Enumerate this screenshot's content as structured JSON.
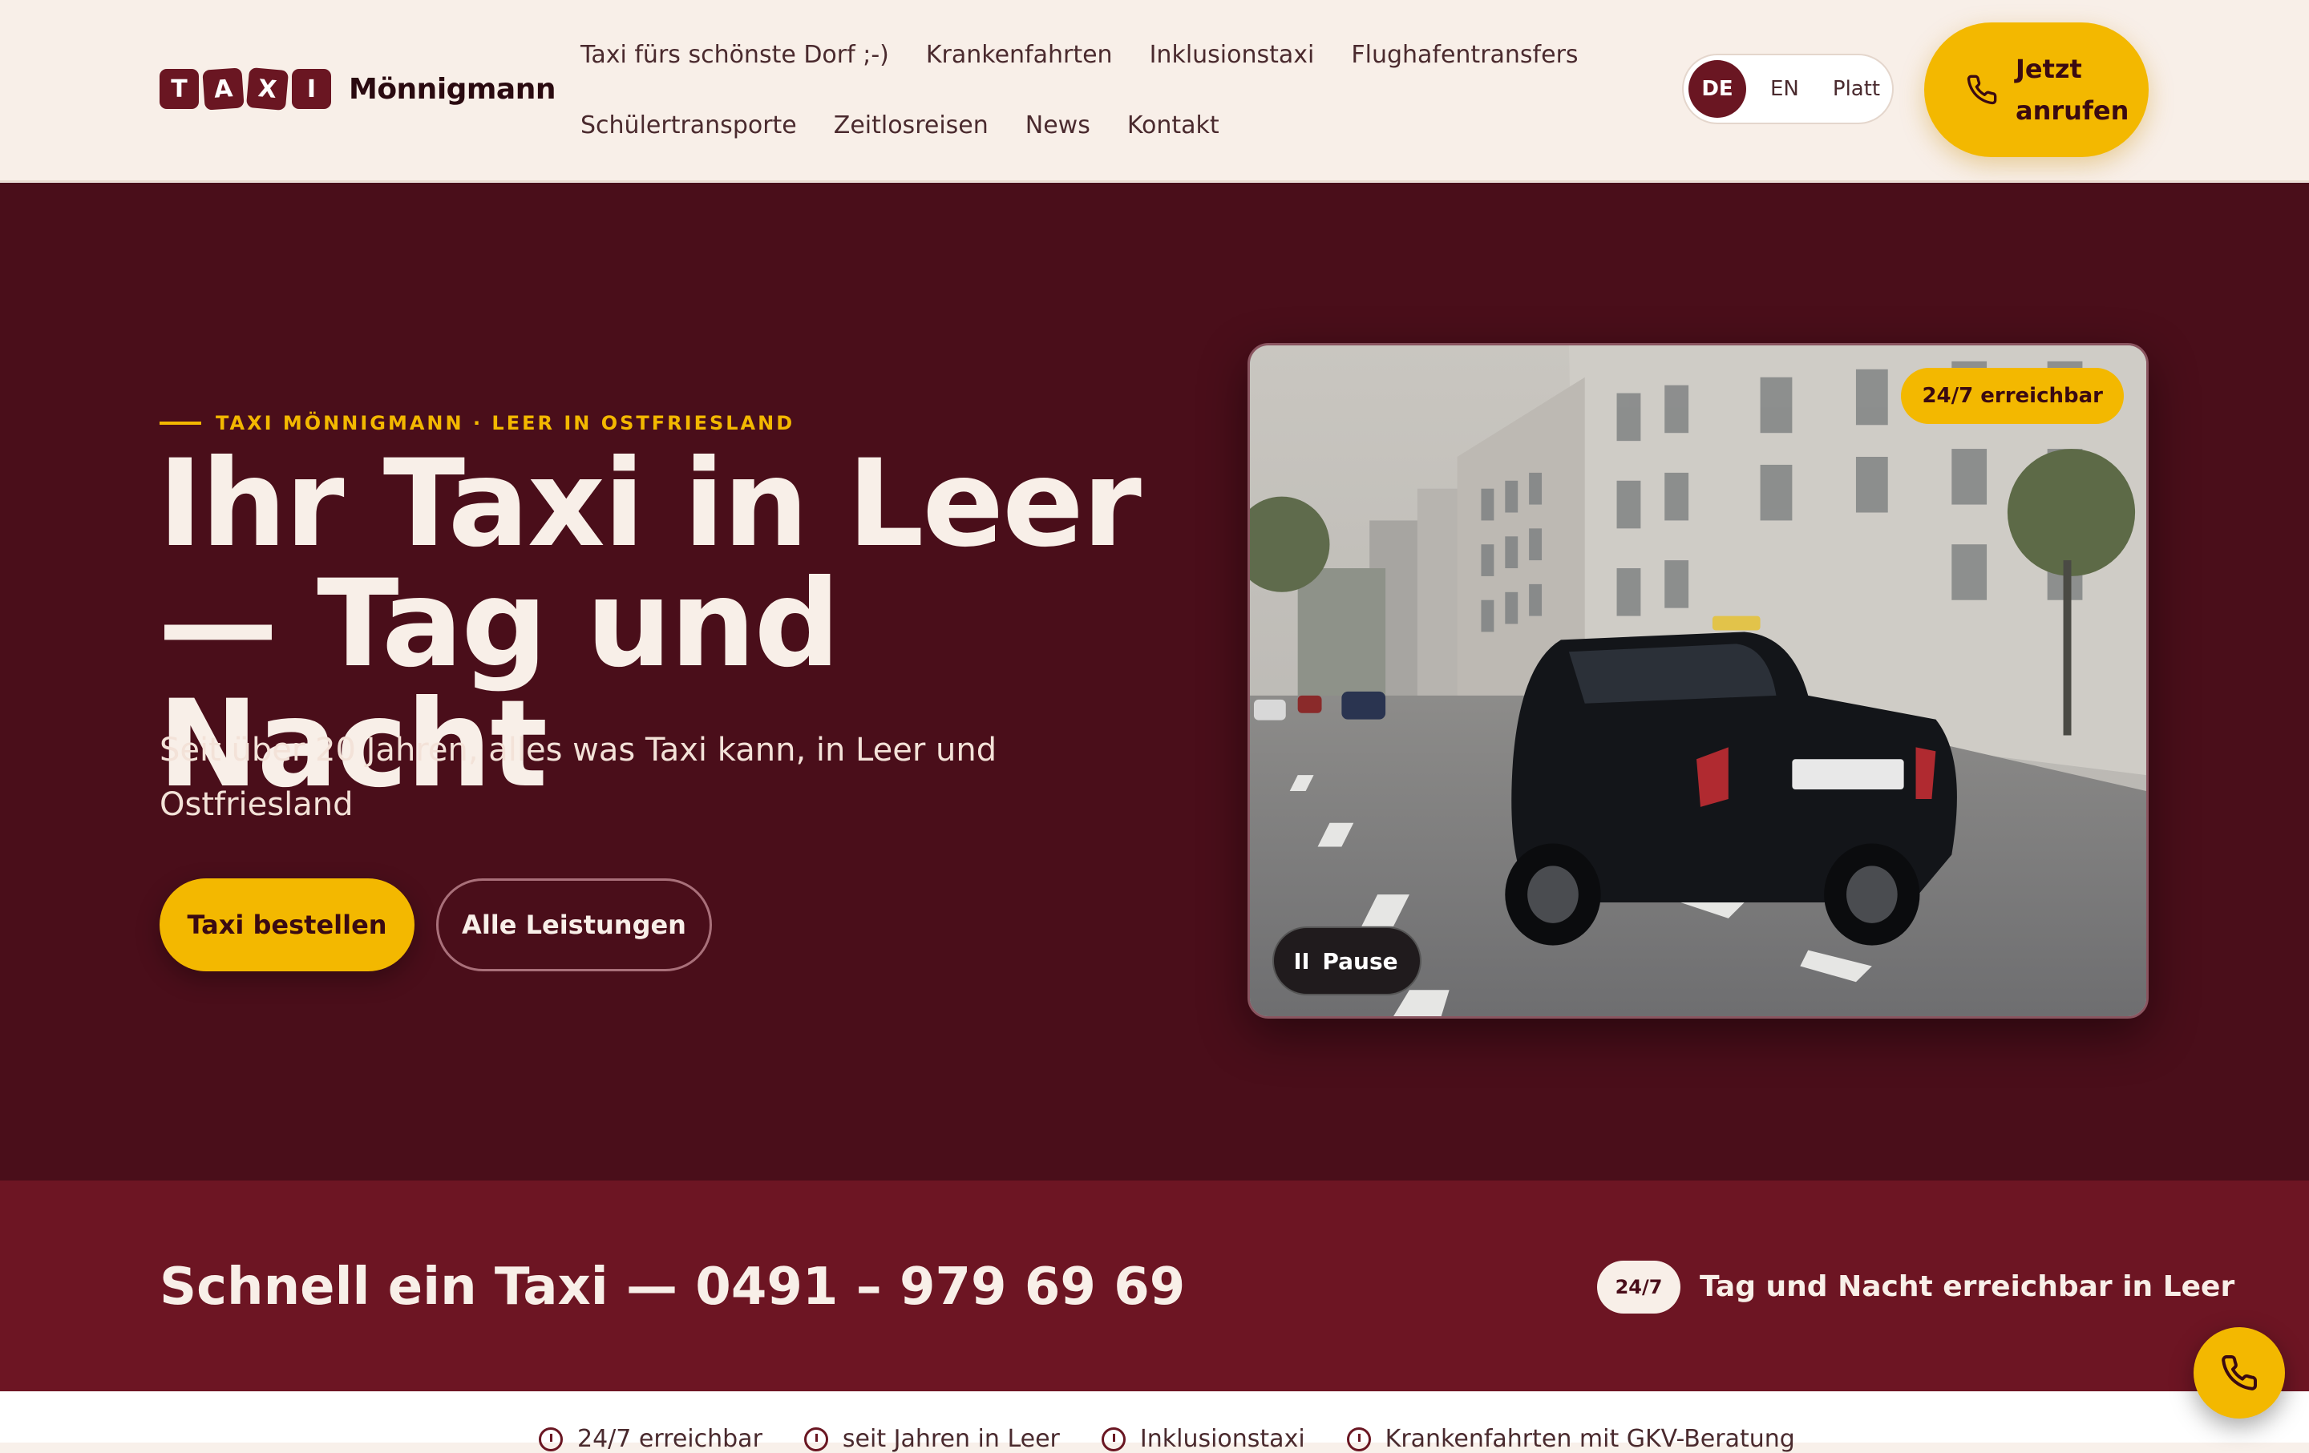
{
  "brand": {
    "logo_letters": [
      "T",
      "A",
      "X",
      "I"
    ],
    "name": "Mönnigmann"
  },
  "nav": {
    "row1": [
      "Taxi fürs schönste Dorf ;-)",
      "Krankenfahrten",
      "Inklusionstaxi",
      "Flughafentransfers"
    ],
    "row2": [
      "Schülertransporte",
      "Zeitlosreisen",
      "News",
      "Kontakt"
    ]
  },
  "languages": {
    "active": "DE",
    "en": "EN",
    "platt": "Platt"
  },
  "header_cta": {
    "icon": "phone-icon",
    "line1": "Jetzt",
    "line2": "anrufen"
  },
  "hero": {
    "eyebrow": "TAXI MÖNNIGMANN · LEER IN OSTFRIESLAND",
    "title_line1": "Ihr Taxi in Leer",
    "title_line2": "— Tag und Nacht",
    "subtitle": "Seit über 20 Jahren, alles was Taxi kann, in Leer und Ostfriesland",
    "primary_button": "Taxi bestellen",
    "secondary_button": "Alle Leistungen"
  },
  "video": {
    "badge": "24/7 erreichbar",
    "pause_label": "Pause",
    "pause_icon": "pause-icon"
  },
  "strip": {
    "title": "Schnell ein Taxi — 0491 – 979 69 69",
    "badge": "24/7",
    "text": "Tag und Nacht erreichbar in Leer"
  },
  "features": [
    "24/7 erreichbar",
    "seit Jahren in Leer",
    "Inklusionstaxi",
    "Krankenfahrten mit GKV-Beratung"
  ],
  "colors": {
    "accent_yellow": "#f3b800",
    "brand_maroon": "#6a1622",
    "hero_bg": "#4a0e1a",
    "strip_bg": "#6d1523",
    "header_bg": "#f8efe8"
  },
  "fab": {
    "icon": "phone-icon"
  }
}
